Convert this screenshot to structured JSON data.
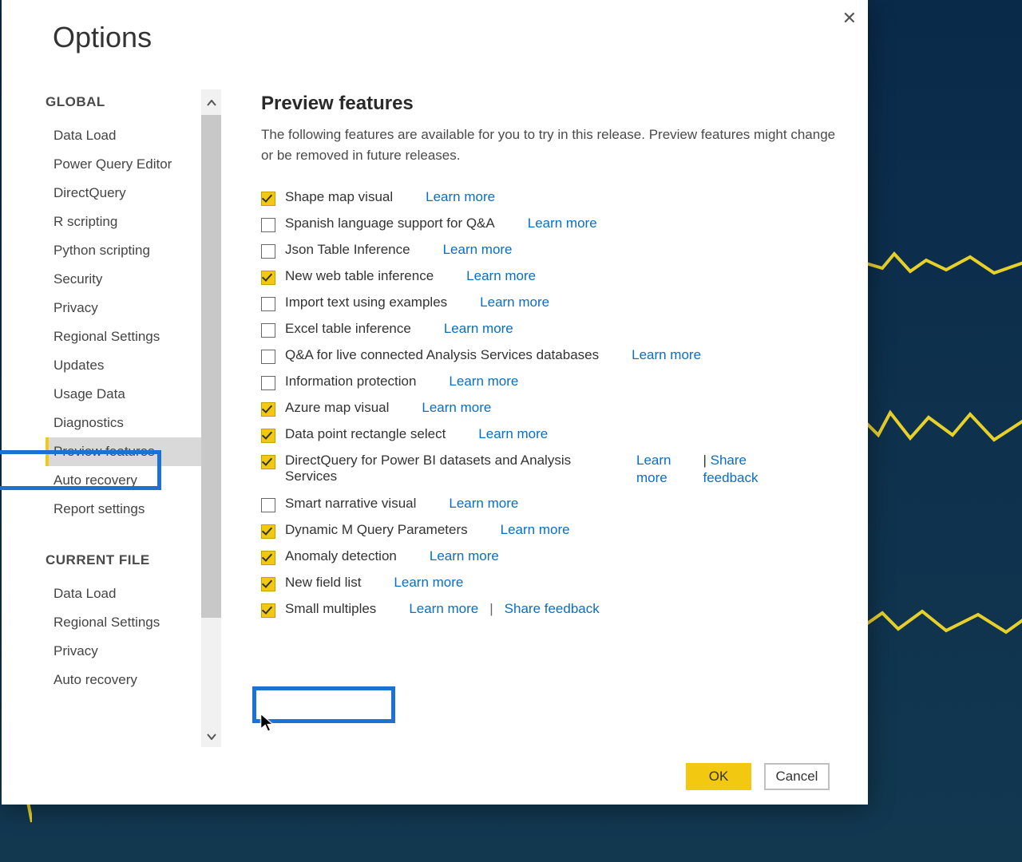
{
  "dialog": {
    "title": "Options",
    "close_icon": "✕"
  },
  "sidebar": {
    "sections": [
      {
        "header": "GLOBAL",
        "items": [
          {
            "label": "Data Load"
          },
          {
            "label": "Power Query Editor"
          },
          {
            "label": "DirectQuery"
          },
          {
            "label": "R scripting"
          },
          {
            "label": "Python scripting"
          },
          {
            "label": "Security"
          },
          {
            "label": "Privacy"
          },
          {
            "label": "Regional Settings"
          },
          {
            "label": "Updates"
          },
          {
            "label": "Usage Data"
          },
          {
            "label": "Diagnostics"
          },
          {
            "label": "Preview features",
            "selected": true
          },
          {
            "label": "Auto recovery"
          },
          {
            "label": "Report settings"
          }
        ]
      },
      {
        "header": "CURRENT FILE",
        "items": [
          {
            "label": "Data Load"
          },
          {
            "label": "Regional Settings"
          },
          {
            "label": "Privacy"
          },
          {
            "label": "Auto recovery"
          }
        ]
      }
    ]
  },
  "main": {
    "heading": "Preview features",
    "description": "The following features are available for you to try in this release. Preview features might change or be removed in future releases.",
    "learn_more": "Learn more",
    "share_feedback": "Share feedback",
    "features": [
      {
        "checked": true,
        "label": "Shape map visual"
      },
      {
        "checked": false,
        "label": "Spanish language support for Q&A"
      },
      {
        "checked": false,
        "label": "Json Table Inference"
      },
      {
        "checked": true,
        "label": "New web table inference"
      },
      {
        "checked": false,
        "label": "Import text using examples"
      },
      {
        "checked": false,
        "label": "Excel table inference"
      },
      {
        "checked": false,
        "label": "Q&A for live connected Analysis Services databases"
      },
      {
        "checked": false,
        "label": "Information protection"
      },
      {
        "checked": true,
        "label": "Azure map visual"
      },
      {
        "checked": true,
        "label": "Data point rectangle select"
      },
      {
        "checked": true,
        "label": "DirectQuery for Power BI datasets and Analysis Services",
        "share": true,
        "wrap": true
      },
      {
        "checked": false,
        "label": "Smart narrative visual"
      },
      {
        "checked": true,
        "label": "Dynamic M Query Parameters"
      },
      {
        "checked": true,
        "label": "Anomaly detection"
      },
      {
        "checked": true,
        "label": "New field list"
      },
      {
        "checked": true,
        "label": "Small multiples",
        "share": true,
        "inline_share": true
      }
    ]
  },
  "footer": {
    "ok": "OK",
    "cancel": "Cancel"
  }
}
